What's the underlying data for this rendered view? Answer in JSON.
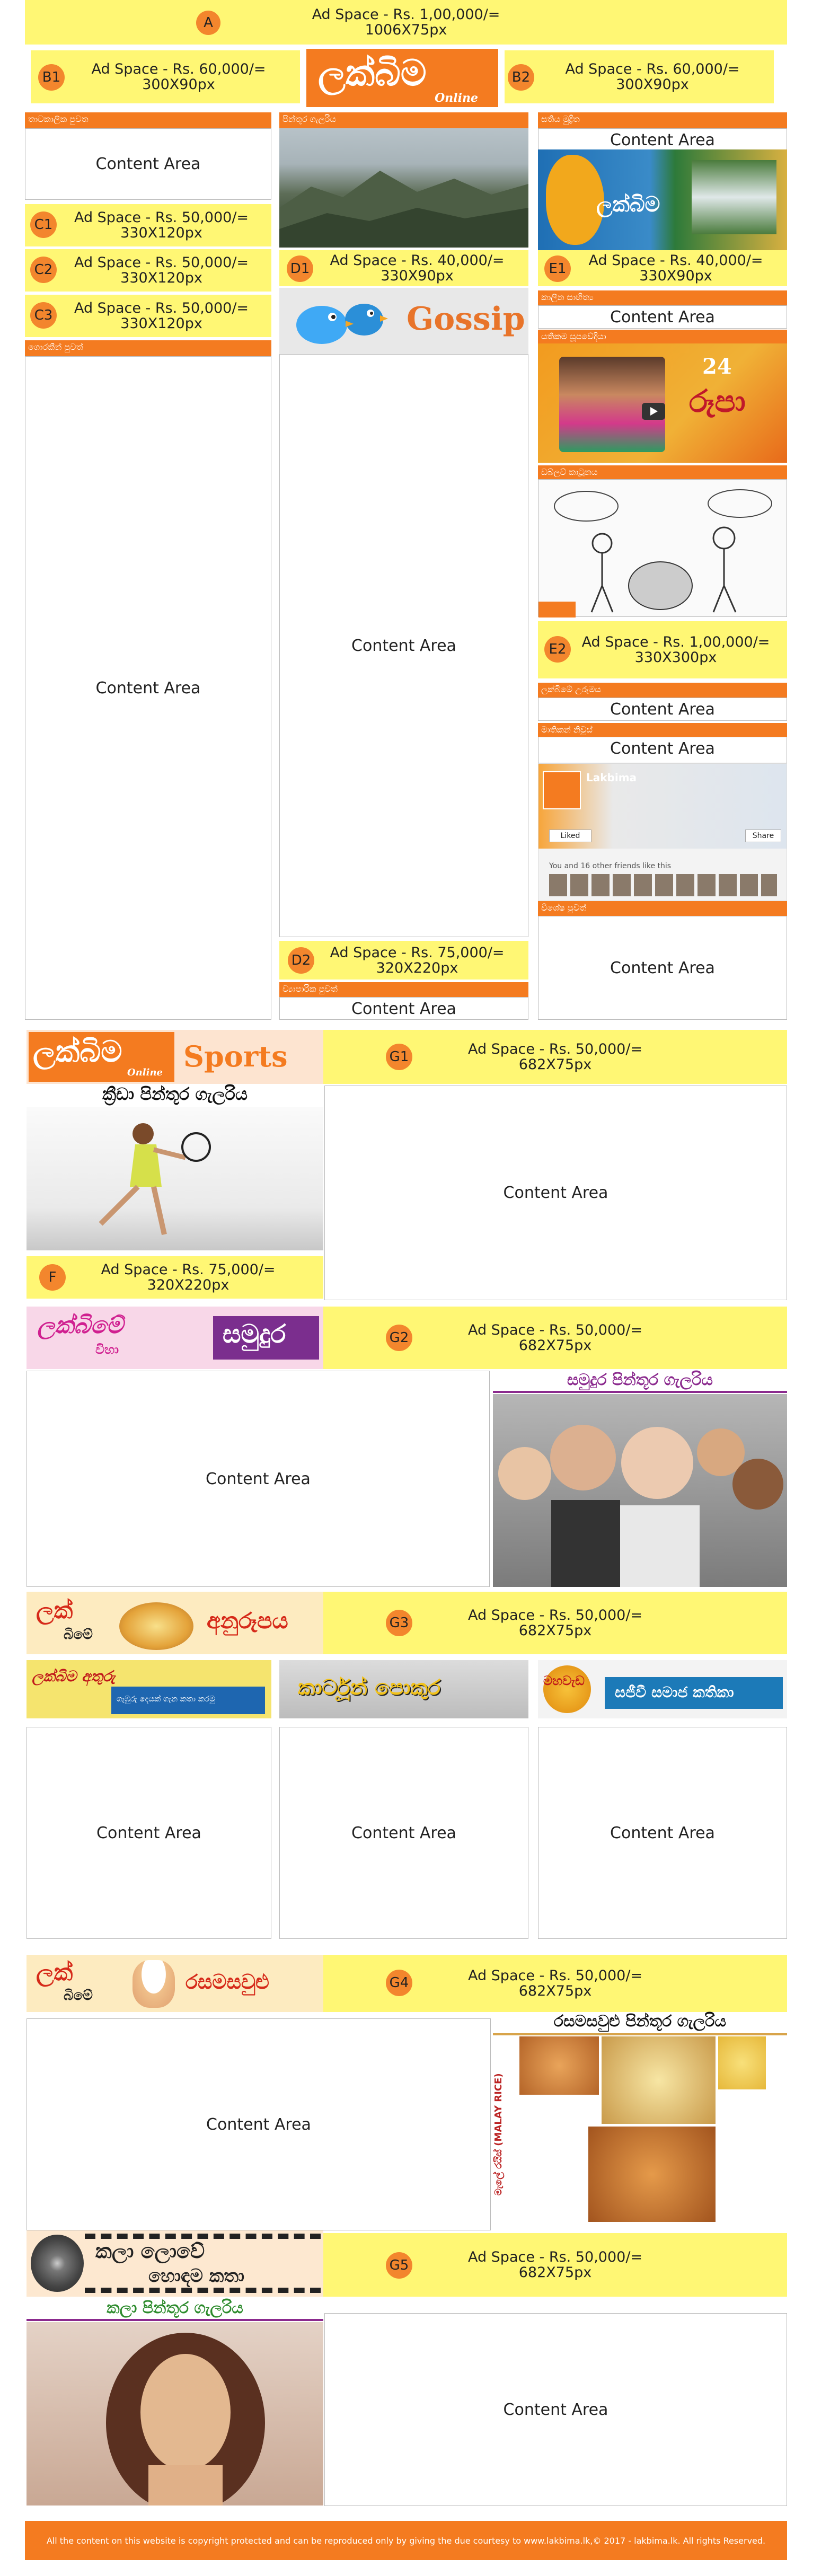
{
  "ad_a": {
    "badge": "A",
    "line1": "Ad Space - Rs. 1,00,000/=",
    "line2": "1006X75px"
  },
  "ad_b1": {
    "badge": "B1",
    "line1": "Ad Space - Rs. 60,000/=",
    "line2": "300X90px"
  },
  "ad_b2": {
    "badge": "B2",
    "line1": "Ad Space - Rs. 60,000/=",
    "line2": "300X90px"
  },
  "logo": {
    "main": "ලක්බිම",
    "sub": "Online"
  },
  "col1": {
    "bar1": "තාවකාලික පුවත",
    "content1": "Content Area",
    "ad_c1": {
      "badge": "C1",
      "line1": "Ad Space - Rs. 50,000/=",
      "line2": "330X120px"
    },
    "ad_c2": {
      "badge": "C2",
      "line1": "Ad Space - Rs. 50,000/=",
      "line2": "330X120px"
    },
    "ad_c3": {
      "badge": "C3",
      "line1": "Ad Space - Rs. 50,000/=",
      "line2": "330X120px"
    },
    "bar2": "ගොරකීන් පුවත්",
    "content2": "Content Area"
  },
  "col2": {
    "bar1": "පින්තූර ගැලරිය",
    "ad_d1": {
      "badge": "D1",
      "line1": "Ad Space - Rs. 40,000/=",
      "line2": "330X90px"
    },
    "gossip": "Gossip",
    "content1": "Content Area",
    "ad_d2": {
      "badge": "D2",
      "line1": "Ad Space - Rs. 75,000/=",
      "line2": "320X220px"
    },
    "bar2": "ව්‍යාපාරික පුවත්",
    "content2": "Content Area"
  },
  "col3": {
    "bar1": "සතිය මුද්‍රිත",
    "content1": "Content Area",
    "promo_text": "ලක්බිම",
    "ad_e1": {
      "badge": "E1",
      "line1": "Ad Space - Rs. 40,000/=",
      "line2": "330X90px"
    },
    "bar2": "කාලීන සාහිත්‍ය",
    "content2": "Content Area",
    "bar3": "යතිකම සූපවේදියා",
    "video_title": "රූපා",
    "video_num": "24",
    "bar4": "ඩබ්ලව් කාටූනය",
    "ad_e2": {
      "badge": "E2",
      "line1": "Ad Space - Rs. 1,00,000/=",
      "line2": "330X300px"
    },
    "bar5": "ලක්බිමේ උරුමය",
    "content3": "Content Area",
    "bar6": "මාතිකන් නිවුස්",
    "content4": "Content Area",
    "fb_name": "Lakbima",
    "fb_liked": "Liked",
    "fb_share": "Share",
    "fb_friends": "You and 16 other friends like this",
    "bar7": "විශේෂ පුවත්",
    "content5": "Content Area"
  },
  "sports": {
    "logo": "ලක්බිම",
    "logo_sub": "Online",
    "logo_word": "Sports",
    "gallery": "ක්‍රීඩා පින්තූර ගැලරිය",
    "ad_f": {
      "badge": "F",
      "line1": "Ad Space - Rs. 75,000/=",
      "line2": "320X220px"
    },
    "ad_g1": {
      "badge": "G1",
      "line1": "Ad Space - Rs. 50,000/=",
      "line2": "682X75px"
    },
    "content": "Content Area"
  },
  "samudura": {
    "logo": "ලක්බිමේ",
    "logo_sub": "විහා",
    "logo_word": "සමුදුර",
    "ad_g2": {
      "badge": "G2",
      "line1": "Ad Space - Rs. 50,000/=",
      "line2": "682X75px"
    },
    "content": "Content Area",
    "gallery": "සමුදුර පින්තූර ගැලරිය"
  },
  "anurupa": {
    "logo": "ලක්",
    "logo_sub": "බිමේ",
    "logo_word": "අනුරූපය",
    "ad_g3": {
      "badge": "G3",
      "line1": "Ad Space - Rs. 50,000/=",
      "line2": "682X75px"
    },
    "banner1": "ලක්බිම අතුරු",
    "banner1_sub": "ගැඹුරු දෙයක් ගැන කතා කරමු",
    "banner2": "කාර්ටූන් පොකුර",
    "banner3_left": "මහවැඩ",
    "banner3_right": "සජීවී සමාජ කතිකා",
    "content1": "Content Area",
    "content2": "Content Area",
    "content3": "Content Area"
  },
  "rasa": {
    "logo": "ලක්",
    "logo_sub": "බිමේ",
    "logo_word": "රසමසවුළු",
    "ad_g4": {
      "badge": "G4",
      "line1": "Ad Space - Rs. 50,000/=",
      "line2": "682X75px"
    },
    "content": "Content Area",
    "gallery": "රසමසවුළු පින්තූර ගැලරිය",
    "side_label": "මැලේ රයිස් (MALAY RICE)"
  },
  "kala": {
    "logo_line1": "කලා ලොවේ",
    "logo_line2": "හොඳම කතා",
    "ad_g5": {
      "badge": "G5",
      "line1": "Ad Space - Rs. 50,000/=",
      "line2": "682X75px"
    },
    "gallery": "කලා පින්තූර ගැලරිය",
    "content": "Content Area"
  },
  "footer": {
    "text": "All the content on this website is copyright protected and can be reproduced only by giving the due courtesy to www.lakbima.lk,© 2017 - lakbima.lk. All rights Reserved."
  },
  "colors": {
    "orange": "#f47b20",
    "yellow": "#fff774",
    "badge": "#f3862d"
  }
}
